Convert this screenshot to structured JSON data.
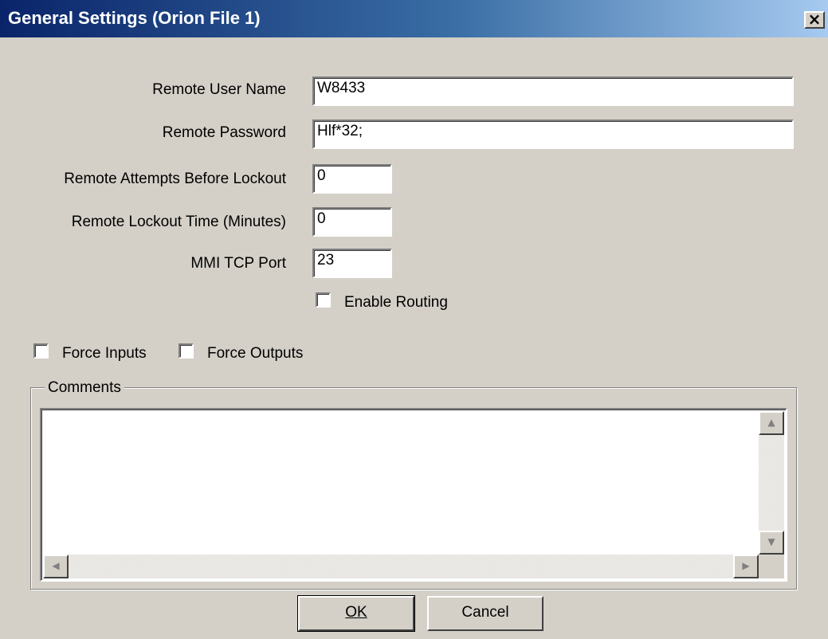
{
  "window": {
    "title": "General Settings (Orion File 1)",
    "close_glyph": "✕"
  },
  "fields": {
    "remote_user_name": {
      "label": "Remote User Name",
      "value": "W8433"
    },
    "remote_password": {
      "label": "Remote Password",
      "value": "Hlf*32;"
    },
    "remote_attempts": {
      "label": "Remote Attempts Before Lockout",
      "value": "0"
    },
    "remote_lockout_time": {
      "label": "Remote Lockout Time (Minutes)",
      "value": "0"
    },
    "mmi_tcp_port": {
      "label": "MMI TCP Port",
      "value": "23"
    }
  },
  "checkboxes": {
    "enable_routing": {
      "label": "Enable Routing",
      "checked": false
    },
    "force_inputs": {
      "label": "Force Inputs",
      "checked": false
    },
    "force_outputs": {
      "label": "Force Outputs",
      "checked": false
    }
  },
  "comments": {
    "title": "Comments",
    "value": ""
  },
  "buttons": {
    "ok": "OK",
    "cancel": "Cancel"
  },
  "icons": {
    "close": "close-icon",
    "scroll_up": "arrow-up-icon",
    "scroll_down": "arrow-down-icon",
    "scroll_left": "arrow-left-icon",
    "scroll_right": "arrow-right-icon"
  }
}
